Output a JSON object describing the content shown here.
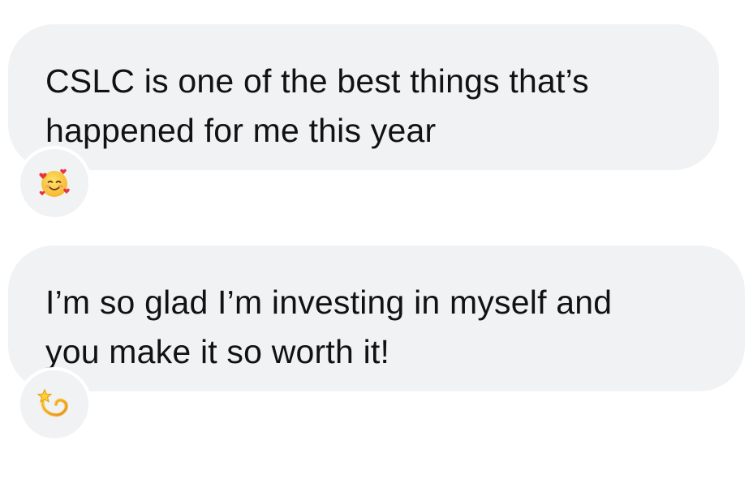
{
  "messages": [
    {
      "text": "CSLC is one of the best things that’s\nhappened for me this year",
      "reaction": {
        "icon": "smiling-face-with-hearts-icon",
        "glyph": "🥰"
      }
    },
    {
      "text": "I’m so glad I’m investing in myself and\nyou make it so worth it!",
      "reaction": {
        "icon": "dizzy-icon",
        "glyph": "💫"
      }
    }
  ],
  "colors": {
    "bubble_background": "#f1f2f4",
    "text": "#121212",
    "page_background": "#ffffff"
  }
}
